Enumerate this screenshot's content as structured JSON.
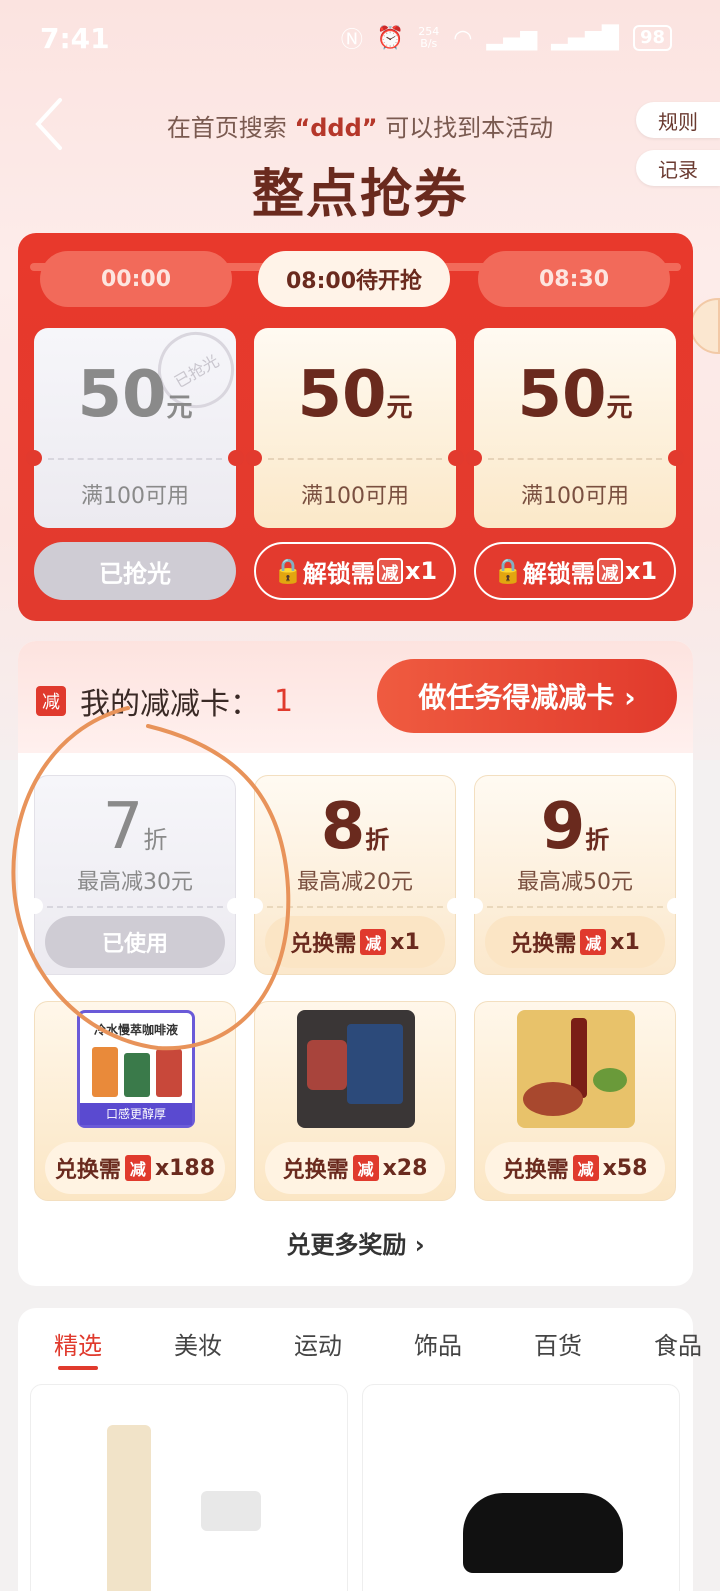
{
  "status": {
    "time": "7:41",
    "net_top": "254",
    "net_bottom": "B/s",
    "battery": "98"
  },
  "header": {
    "subtitle_pre": "在首页搜索",
    "subtitle_key": "“ddd”",
    "subtitle_post": "可以找到本活动",
    "title": "整点抢券",
    "rules": "规则",
    "records": "记录"
  },
  "slots": [
    {
      "time": "00:00"
    },
    {
      "time": "08:00待开抢"
    },
    {
      "time": "08:30"
    }
  ],
  "coupons": [
    {
      "amount": "50",
      "unit": "元",
      "cond": "满100可用",
      "stamp": "已抢光",
      "action": "已抢光"
    },
    {
      "amount": "50",
      "unit": "元",
      "cond": "满100可用",
      "action_pre": "解锁需",
      "action_icon": "减",
      "action_post": "x1"
    },
    {
      "amount": "50",
      "unit": "元",
      "cond": "满100可用",
      "action_pre": "解锁需",
      "action_icon": "减",
      "action_post": "x1"
    }
  ],
  "cards": {
    "icon": "减",
    "title": "我的减减卡：",
    "count": "1",
    "task_button": "做任务得减减卡 ›",
    "discounts": [
      {
        "value": "7",
        "unit": "折",
        "cap": "最高减30元",
        "action": "已使用"
      },
      {
        "value": "8",
        "unit": "折",
        "cap": "最高减20元",
        "action_pre": "兑换需",
        "action_icon": "减",
        "action_post": "x1"
      },
      {
        "value": "9",
        "unit": "折",
        "cap": "最高减50元",
        "action_pre": "兑换需",
        "action_icon": "减",
        "action_post": "x1"
      }
    ],
    "products": [
      {
        "label": "冷水慢萃咖啡液",
        "sub": "口感更醇厚",
        "action_pre": "兑换需",
        "action_icon": "减",
        "action_post": "x188"
      },
      {
        "action_pre": "兑换需",
        "action_icon": "减",
        "action_post": "x28"
      },
      {
        "action_pre": "兑换需",
        "action_icon": "减",
        "action_post": "x58"
      }
    ],
    "more": "兑更多奖励 ›"
  },
  "tabs": [
    "精选",
    "美妆",
    "运动",
    "饰品",
    "百货",
    "食品"
  ],
  "colors": {
    "accent": "#e03a2d",
    "brown": "#6a2a1e",
    "annotation": "#e8935a"
  }
}
